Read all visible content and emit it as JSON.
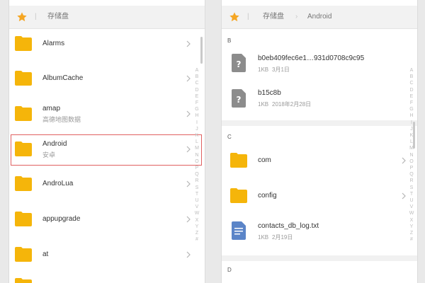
{
  "left": {
    "breadcrumb": [
      "存储盘"
    ],
    "items": [
      {
        "name": "Alarms",
        "sub": ""
      },
      {
        "name": "AlbumCache",
        "sub": ""
      },
      {
        "name": "amap",
        "sub": "高德地图数据"
      },
      {
        "name": "Android",
        "sub": "安卓"
      },
      {
        "name": "AndroLua",
        "sub": ""
      },
      {
        "name": "appupgrade",
        "sub": ""
      },
      {
        "name": "at",
        "sub": ""
      }
    ],
    "index_letters": [
      "A",
      "B",
      "C",
      "D",
      "E",
      "F",
      "G",
      "H",
      "I",
      "J",
      "K",
      "L",
      "M",
      "N",
      "O",
      "P",
      "Q",
      "R",
      "S",
      "T",
      "U",
      "V",
      "W",
      "X",
      "Y",
      "Z",
      "#"
    ]
  },
  "right": {
    "breadcrumb": [
      "存储盘",
      "Android"
    ],
    "sections": [
      {
        "letter": "B",
        "items": [
          {
            "name": "b0eb409fec6e1…931d0708c9c95",
            "size": "1KB",
            "date": "3月1日",
            "kind": "unknown-file"
          },
          {
            "name": "b15c8b",
            "size": "1KB",
            "date": "2018年2月28日",
            "kind": "unknown-file"
          }
        ]
      },
      {
        "letter": "C",
        "items": [
          {
            "name": "com",
            "kind": "folder"
          },
          {
            "name": "config",
            "kind": "folder"
          },
          {
            "name": "contacts_db_log.txt",
            "size": "1KB",
            "date": "2月19日",
            "kind": "txt"
          }
        ]
      },
      {
        "letter": "D",
        "items": []
      }
    ],
    "index_letters": [
      "A",
      "B",
      "C",
      "D",
      "E",
      "F",
      "G",
      "H",
      "I",
      "J",
      "K",
      "L",
      "M",
      "N",
      "O",
      "P",
      "Q",
      "R",
      "S",
      "T",
      "U",
      "V",
      "W",
      "X",
      "Y",
      "Z",
      "#"
    ]
  },
  "colors": {
    "folder": "#f5b50a",
    "star": "#f5a623",
    "selection": "#e06060",
    "txt_icon": "#5b85c8"
  }
}
